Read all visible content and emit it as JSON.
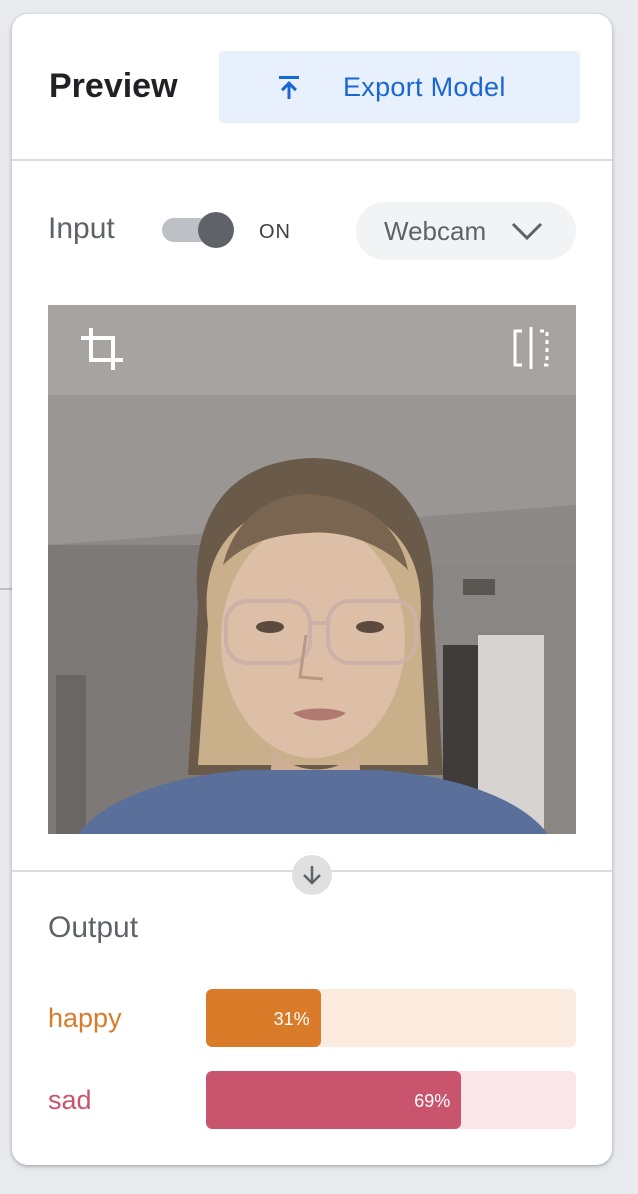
{
  "header": {
    "title": "Preview",
    "export_label": "Export Model"
  },
  "input": {
    "label": "Input",
    "toggle_on": true,
    "toggle_state": "ON",
    "source": "Webcam"
  },
  "output": {
    "label": "Output",
    "classes": [
      {
        "name": "happy",
        "percent_label": "31%",
        "value": 0.31,
        "color": "#da7b2a",
        "track_color": "#fcece0"
      },
      {
        "name": "sad",
        "percent_label": "69%",
        "value": 0.69,
        "color": "#c9546e",
        "track_color": "#fae6e8"
      }
    ]
  },
  "colors": {
    "accent": "#1967d2",
    "accent_bg": "#e8f0fe"
  },
  "icons": {
    "export": "upload-arrow-icon",
    "dropdown": "chevron-down-icon",
    "crop": "crop-icon",
    "flip": "flip-icon",
    "flow": "arrow-down-icon"
  }
}
